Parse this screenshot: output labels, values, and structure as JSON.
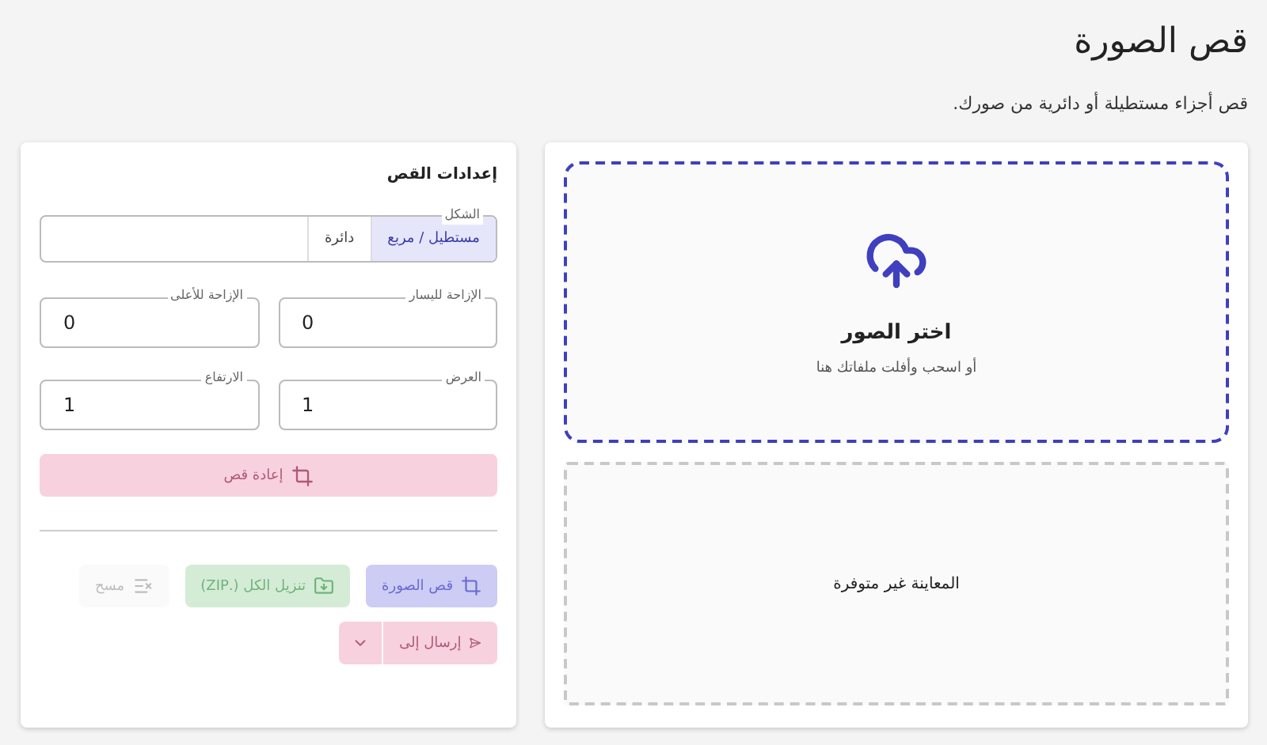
{
  "page": {
    "title": "قص الصورة",
    "subtitle": "قص أجزاء مستطيلة أو دائرية من صورك."
  },
  "upload": {
    "title": "اختر الصور",
    "hint": "أو اسحب وأفلت ملفاتك هنا"
  },
  "preview": {
    "message": "المعاينة غير متوفرة"
  },
  "settings": {
    "title": "إعدادات القص",
    "shape": {
      "label": "الشكل",
      "options": [
        {
          "label": "مستطيل / مربع",
          "selected": true
        },
        {
          "label": "دائرة",
          "selected": false
        }
      ]
    },
    "fields": [
      {
        "label": "الإزاحة لليسار",
        "value": "0"
      },
      {
        "label": "الإزاحة للأعلى",
        "value": "0"
      },
      {
        "label": "العرض",
        "value": "1"
      },
      {
        "label": "الارتفاع",
        "value": "1"
      }
    ],
    "recrop": {
      "label": "إعادة قص",
      "disabled": true
    },
    "actions": [
      {
        "kind": "crop",
        "label": "قص الصورة",
        "disabled": true
      },
      {
        "kind": "download",
        "label": "تنزيل الكل (.ZIP)",
        "disabled": true
      },
      {
        "kind": "clear",
        "label": "مسح",
        "disabled": true
      }
    ],
    "send": {
      "label": "إرسال إلى",
      "disabled": true
    }
  }
}
